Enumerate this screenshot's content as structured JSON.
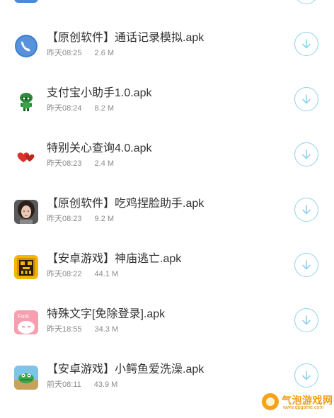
{
  "files": [
    {
      "icon": "phone-icon",
      "name": "【原创软件】通话记录模拟.apk",
      "time": "昨天08:25",
      "size": "2.6 M"
    },
    {
      "icon": "alipay-assistant-icon",
      "name": "支付宝小助手1.0.apk",
      "time": "昨天08:24",
      "size": "8.2 M"
    },
    {
      "icon": "hearts-icon",
      "name": "特别关心查询4.0.apk",
      "time": "昨天08:23",
      "size": "2.4 M"
    },
    {
      "icon": "avatar-face-icon",
      "name": "【原创软件】吃鸡捏脸助手.apk",
      "time": "昨天08:23",
      "size": "9.2 M"
    },
    {
      "icon": "temple-run-icon",
      "name": "【安卓游戏】神庙逃亡.apk",
      "time": "昨天08:22",
      "size": "44.1 M"
    },
    {
      "icon": "font-app-icon",
      "name": "特殊文字[免除登录].apk",
      "time": "昨天18:55",
      "size": "34.3 M"
    },
    {
      "icon": "crocodile-game-icon",
      "name": "【安卓游戏】小鳄鱼爱洗澡.apk",
      "time": "前天08:11",
      "size": "43.9 M"
    }
  ],
  "font_icon_text": "Font",
  "watermark": {
    "name": "气泡游戏网",
    "url": "www.qpgame.com"
  },
  "colors": {
    "download_ring": "#8fd3ea",
    "title": "#333333",
    "meta": "#8a8a8a"
  }
}
